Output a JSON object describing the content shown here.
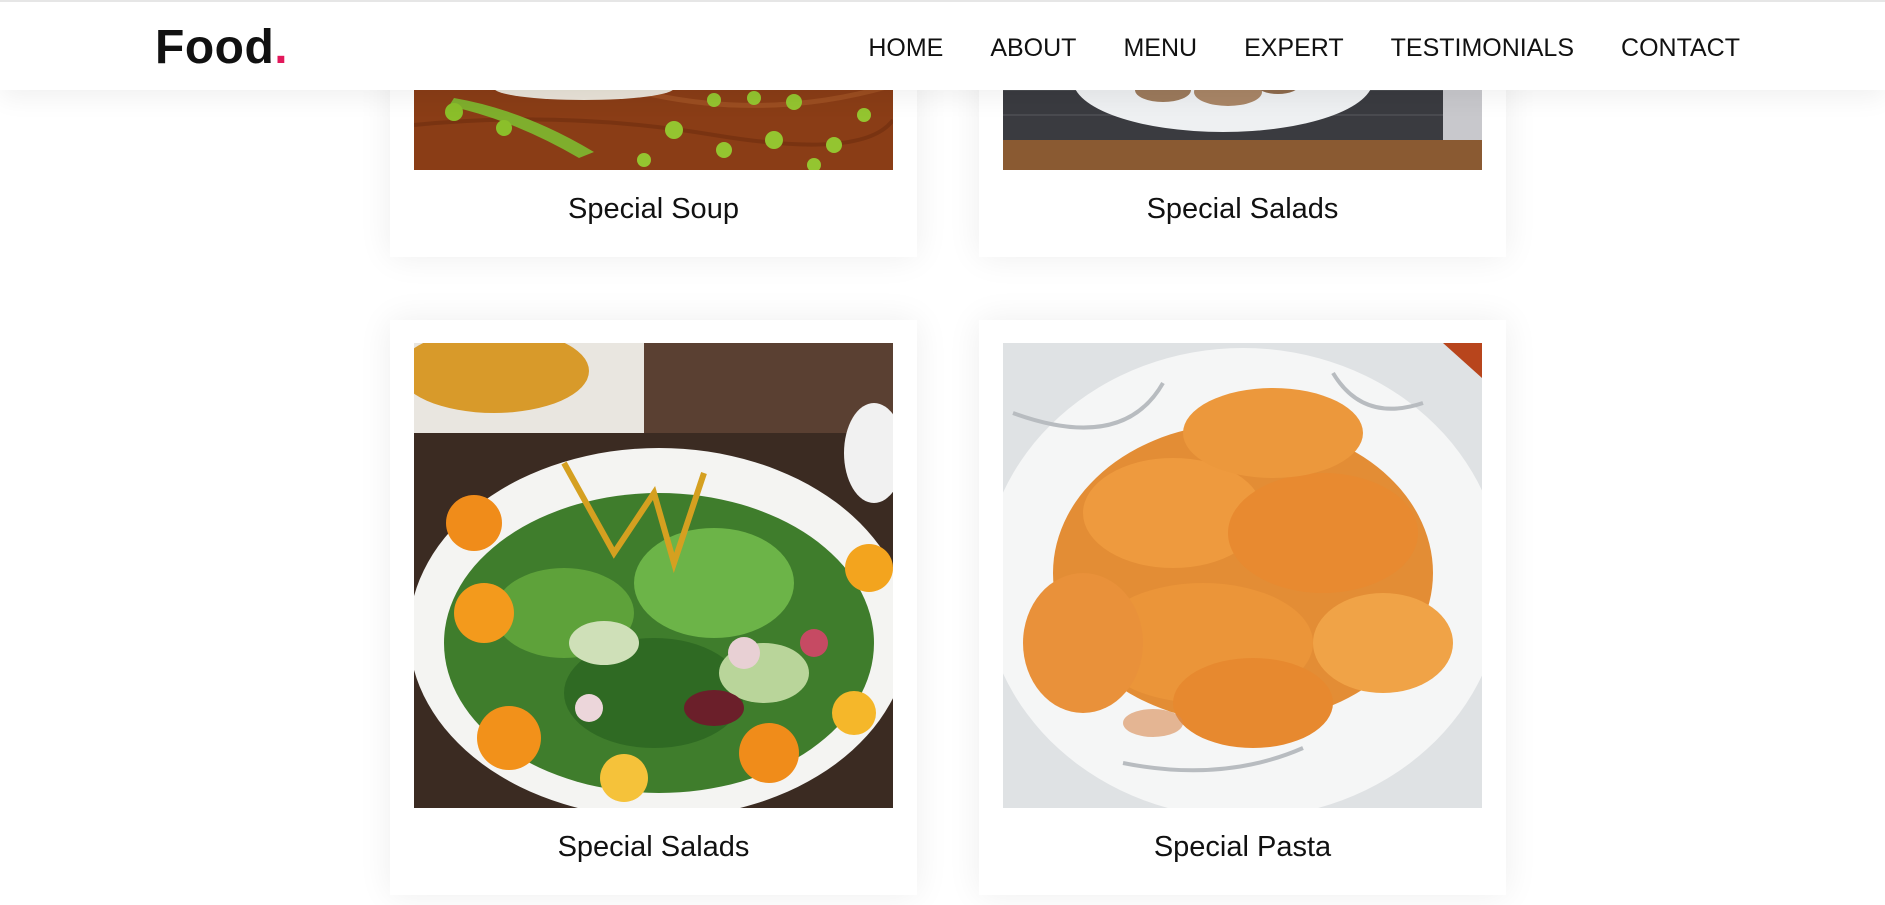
{
  "header": {
    "logo_text": "Food",
    "logo_dot": ".",
    "nav": [
      {
        "label": "HOME"
      },
      {
        "label": "ABOUT"
      },
      {
        "label": "MENU"
      },
      {
        "label": "EXPERT"
      },
      {
        "label": "TESTIMONIALS"
      },
      {
        "label": "CONTACT"
      }
    ]
  },
  "menu": {
    "cards": [
      {
        "title": "Special Soup",
        "image": "peas-soup-photo"
      },
      {
        "title": "Special Salads",
        "image": "plated-dish-photo"
      },
      {
        "title": "Special Salads",
        "image": "salad-bowl-photo"
      },
      {
        "title": "Special Pasta",
        "image": "fusilli-pasta-photo"
      }
    ]
  },
  "colors": {
    "accent": "#e2185b",
    "text": "#111111",
    "background": "#ffffff"
  }
}
